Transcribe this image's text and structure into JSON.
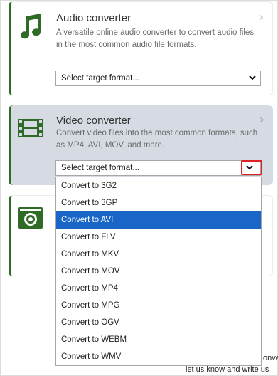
{
  "audio_card": {
    "title": "Audio converter",
    "description": "A versatile online audio converter to convert audio files in the most common audio file formats.",
    "select_value": "Select target format..."
  },
  "video_card": {
    "title": "Video converter",
    "description": "Convert video files into the most common formats, such as MP4, AVI, MOV, and more.",
    "select_value": "Select target format..."
  },
  "dropdown": {
    "options": [
      "Convert to 3G2",
      "Convert to 3GP",
      "Convert to AVI",
      "Convert to FLV",
      "Convert to MKV",
      "Convert to MOV",
      "Convert to MP4",
      "Convert to MPG",
      "Convert to OGV",
      "Convert to WEBM",
      "Convert to WMV"
    ],
    "selected": "Convert to AVI"
  },
  "footer": {
    "line1_tail": "onve",
    "line2": "let us know and write us"
  },
  "colors": {
    "accent_green": "#2f6a27",
    "highlight_blue": "#1a66c8",
    "annotation_red": "#e02020"
  }
}
